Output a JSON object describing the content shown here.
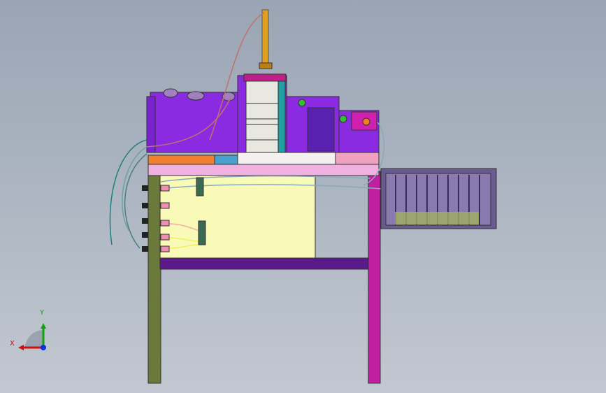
{
  "viewport": {
    "background_top": "#9aa5b4",
    "background_bottom": "#c2c8d1"
  },
  "triad": {
    "x_label": "X",
    "y_label": "Y",
    "x_color": "#d01010",
    "y_color": "#10a010",
    "z_color": "#1030e0"
  },
  "colors": {
    "top_purple": "#8a2be2",
    "magenta": "#c020a0",
    "olive_leg": "#6b7a3a",
    "panel_yellow": "#fafab8",
    "table_pink": "#f0b0e0",
    "crate_purple": "#6a5a90",
    "teal_edge": "#20a0a0",
    "brass": "#e0a020"
  }
}
